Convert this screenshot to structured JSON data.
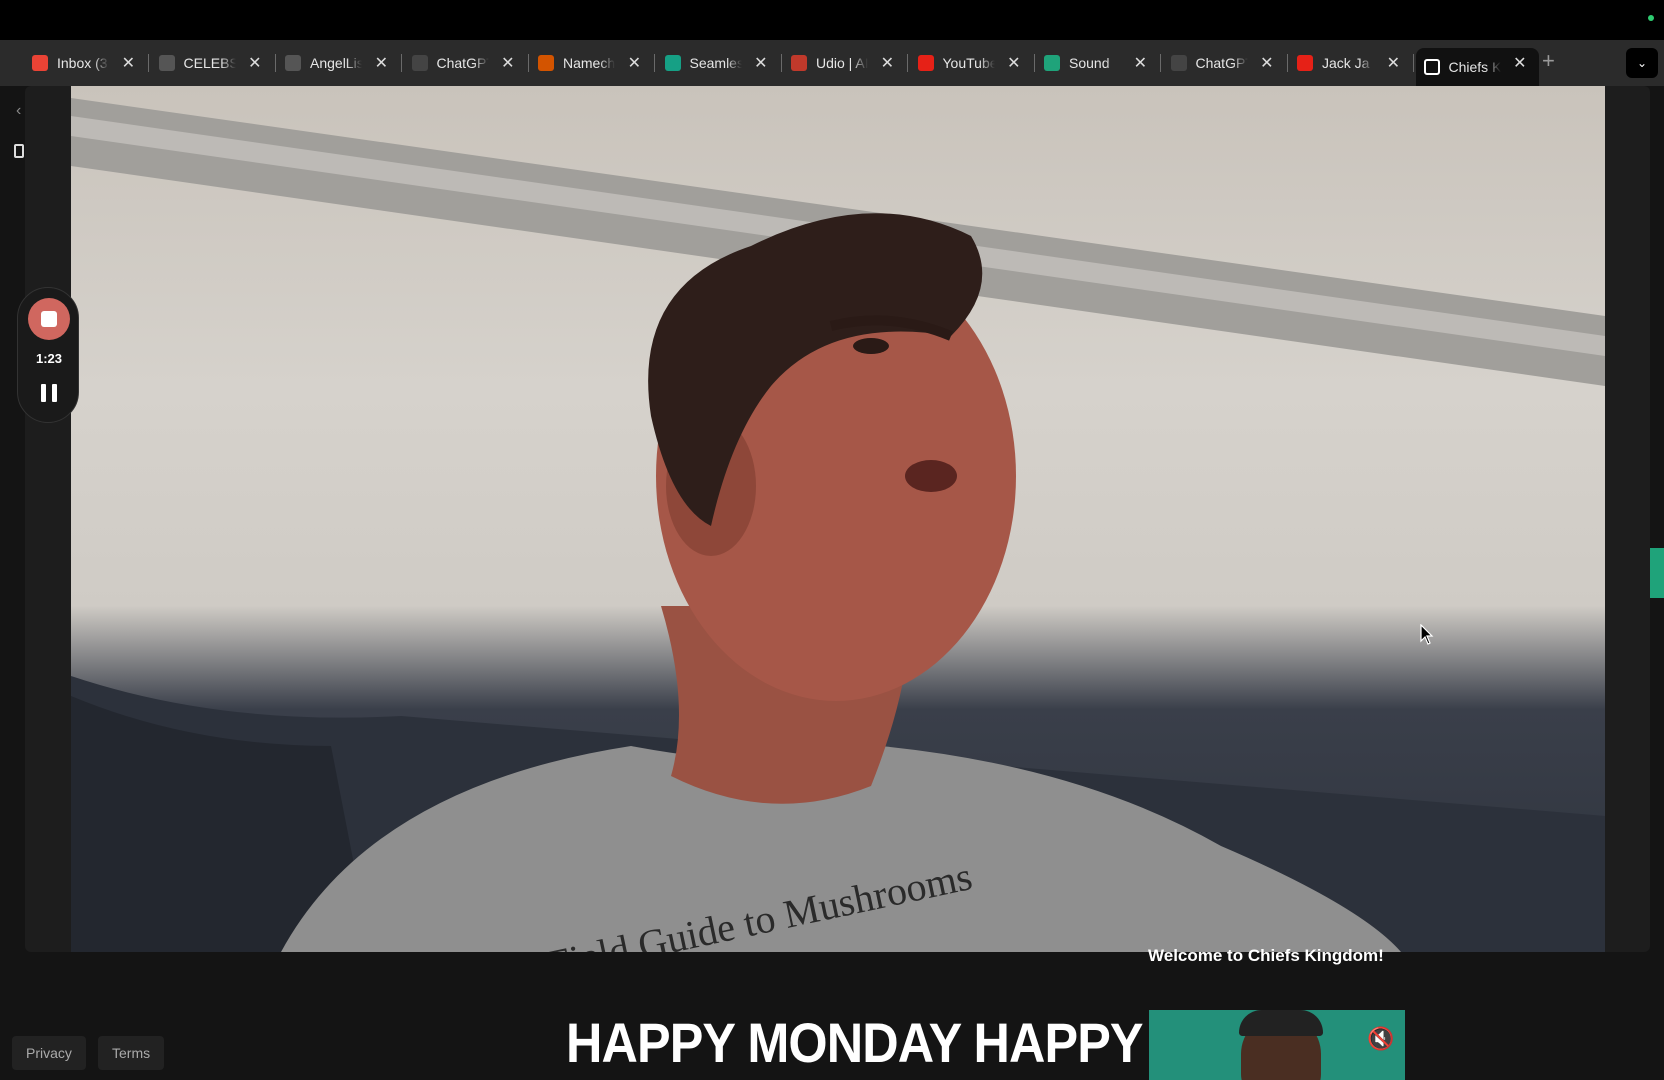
{
  "browser": {
    "tabs": [
      {
        "title": "Inbox (3",
        "icon": "gmail-icon",
        "color": "#ea4335"
      },
      {
        "title": "CELEBS",
        "icon": "doc-icon",
        "color": "#555555"
      },
      {
        "title": "AngelList",
        "icon": "hand-icon",
        "color": "#555555"
      },
      {
        "title": "ChatGPT",
        "icon": "openai-icon",
        "color": "#444444"
      },
      {
        "title": "Namecheap",
        "icon": "namecheap-icon",
        "color": "#d35400"
      },
      {
        "title": "Seamless",
        "icon": "seamless-icon",
        "color": "#16a085"
      },
      {
        "title": "Udio | AI",
        "icon": "udio-icon",
        "color": "#c0392b"
      },
      {
        "title": "YouTube",
        "icon": "youtube-icon",
        "color": "#e62117"
      },
      {
        "title": "Sound",
        "icon": "plus-cross-icon",
        "color": "#1fa37a"
      },
      {
        "title": "ChatGPT",
        "icon": "openai-icon",
        "color": "#444444"
      },
      {
        "title": "Jack Ja",
        "icon": "youtube-icon",
        "color": "#e62117"
      },
      {
        "title": "Chiefs K",
        "icon": "page-icon",
        "color": "#ffffff"
      }
    ],
    "new_tab": "+",
    "menu": "⌄"
  },
  "recorder": {
    "time": "1:23"
  },
  "page": {
    "welcome": "Welcome to Chiefs Kingdom!",
    "headline": "HAPPY MONDAY HAPPY",
    "footer": {
      "privacy": "Privacy",
      "terms": "Terms"
    }
  },
  "colors": {
    "record": "#d0675f",
    "accent": "#1fa37a"
  }
}
